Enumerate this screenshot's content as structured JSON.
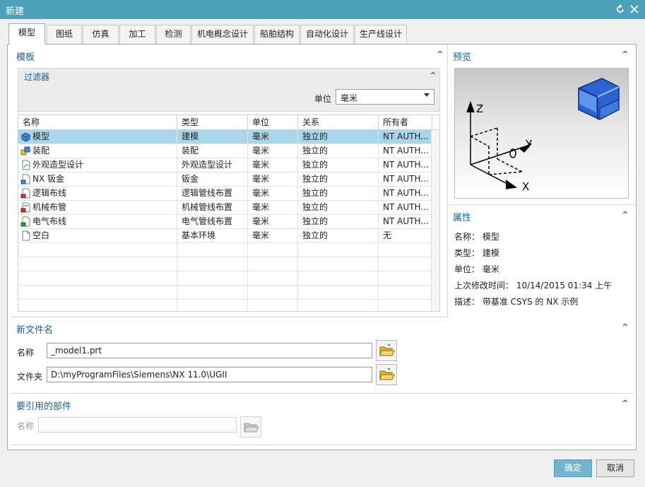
{
  "window": {
    "title": "新建"
  },
  "tabs": [
    "模型",
    "图纸",
    "仿真",
    "加工",
    "检测",
    "机电概念设计",
    "船舶结构",
    "自动化设计",
    "生产线设计"
  ],
  "template": {
    "title": "模板",
    "filter_title": "过滤器",
    "unit_label": "单位",
    "unit_value": "毫米",
    "columns": [
      "名称",
      "类型",
      "单位",
      "关系",
      "所有者"
    ],
    "rows": [
      {
        "name": "模型",
        "type": "建模",
        "unit": "毫米",
        "relation": "独立的",
        "owner": "NT AUTH...",
        "icon": "model-icon"
      },
      {
        "name": "装配",
        "type": "装配",
        "unit": "毫米",
        "relation": "独立的",
        "owner": "NT AUTH...",
        "icon": "assembly-icon"
      },
      {
        "name": "外观造型设计",
        "type": "外观造型设计",
        "unit": "毫米",
        "relation": "独立的",
        "owner": "NT AUTH...",
        "icon": "shape-studio-icon"
      },
      {
        "name": "NX 钣金",
        "type": "钣金",
        "unit": "毫米",
        "relation": "独立的",
        "owner": "NT AUTH...",
        "icon": "sheet-metal-icon"
      },
      {
        "name": "逻辑布线",
        "type": "逻辑管线布置",
        "unit": "毫米",
        "relation": "独立的",
        "owner": "NT AUTH...",
        "icon": "logical-routing-icon"
      },
      {
        "name": "机械布管",
        "type": "机械管线布置",
        "unit": "毫米",
        "relation": "独立的",
        "owner": "NT AUTH...",
        "icon": "mechanical-routing-icon"
      },
      {
        "name": "电气布线",
        "type": "电气管线布置",
        "unit": "毫米",
        "relation": "独立的",
        "owner": "NT AUTH...",
        "icon": "electrical-routing-icon"
      },
      {
        "name": "空白",
        "type": "基本环境",
        "unit": "毫米",
        "relation": "独立的",
        "owner": "无",
        "icon": "blank-document-icon"
      }
    ]
  },
  "preview": {
    "title": "预览",
    "axes": [
      "Z",
      "Y",
      "X"
    ]
  },
  "properties": {
    "title": "属性",
    "name": "名称： 模型",
    "type": "类型： 建模",
    "unit": "单位： 毫米",
    "modified": "上次修改时间： 10/14/2015 01:34 上午",
    "description": "描述： 带基准 CSYS 的 NX 示例"
  },
  "new_file": {
    "title": "新文件名",
    "name_label": "名称",
    "name_value": "_model1.prt",
    "folder_label": "文件夹",
    "folder_value": "D:\\myProgramFiles\\Siemens\\NX 11.0\\UGII"
  },
  "reference": {
    "title": "要引用的部件",
    "name_label": "名称",
    "name_value": ""
  },
  "buttons": {
    "ok": "确定",
    "cancel": "取消"
  },
  "colors": {
    "titlebar": "#4da1bb",
    "selection": "#a9d7e9",
    "section_title": "#1a5f9e",
    "ok_button": "#73b5d1"
  }
}
